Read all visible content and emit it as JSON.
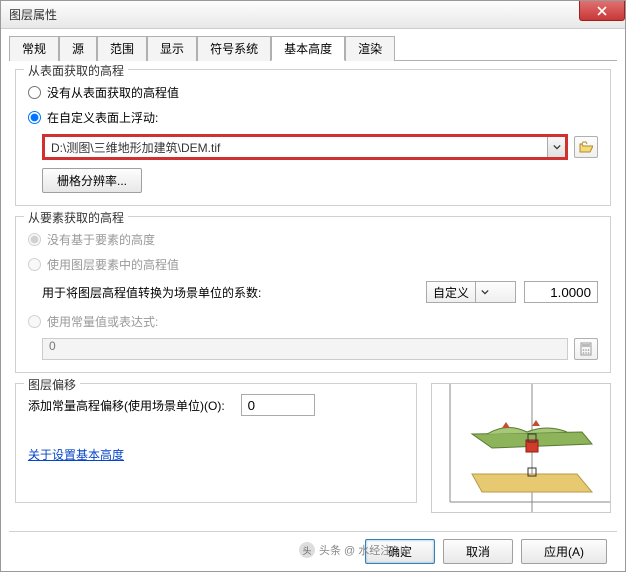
{
  "window": {
    "title": "图层属性"
  },
  "tabs": [
    "常规",
    "源",
    "范围",
    "显示",
    "符号系统",
    "基本高度",
    "渲染"
  ],
  "active_tab_index": 5,
  "group1": {
    "legend": "从表面获取的高程",
    "opt_none": "没有从表面获取的高程值",
    "opt_float": "在自定义表面上浮动:",
    "path": "D:\\测图\\三维地形加建筑\\DEM.tif",
    "raster_res_btn": "栅格分辨率..."
  },
  "group2": {
    "legend": "从要素获取的高程",
    "opt_none": "没有基于要素的高度",
    "opt_layer": "使用图层要素中的高程值",
    "factor_label": "用于将图层高程值转换为场景单位的系数:",
    "factor_unit": "自定义",
    "factor_value": "1.0000",
    "opt_const": "使用常量值或表达式:",
    "const_value": "0"
  },
  "group3": {
    "legend": "图层偏移",
    "offset_label": "添加常量高程偏移(使用场景单位)(O):",
    "offset_value": "0"
  },
  "help_link": "关于设置基本高度",
  "footer": {
    "ok": "确定",
    "cancel": "取消",
    "apply": "应用(A)"
  },
  "watermark": "头条 @ 水经注GIS"
}
